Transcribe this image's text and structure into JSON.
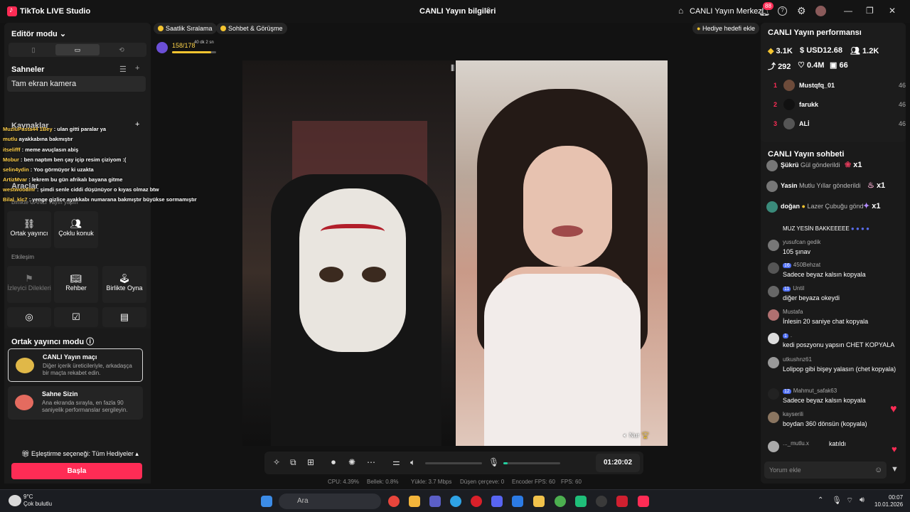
{
  "titlebar": {
    "app_title": "TikTok LIVE Studio",
    "center_title": "CANLI Yayın bilgileri",
    "live_center": "CANLI Yayın Merkezi",
    "notif_count": "88"
  },
  "left": {
    "mode_label": "Editör modu",
    "scenes_label": "Sahneler",
    "scene_item": "Tam ekran kamera",
    "sources_label": "Kaynaklar",
    "tools_label": "Araçlar",
    "together_label": "Birlikte CANLI Yayın yapın",
    "tools": [
      {
        "label": "Ortak yayıncı",
        "icon": "link-icon"
      },
      {
        "label": "Çoklu konuk",
        "icon": "users-icon"
      }
    ],
    "interaction_label": "Etkileşim",
    "interaction_tools": [
      {
        "label": "İzleyici Dilekleri",
        "icon": "wish-icon"
      },
      {
        "label": "Rehber",
        "icon": "book-icon"
      },
      {
        "label": "Birlikte Oyna",
        "icon": "joystick-icon"
      }
    ],
    "cohost_mode": "Ortak yayıncı modu",
    "cards": [
      {
        "title": "CANLI Yayın maçı",
        "desc": "Diğer içerik üreticileriyle, arkadaşça bir maçta rekabet edin."
      },
      {
        "title": "Sahne Sizin",
        "desc": "Ana ekranda sırayla, en fazla 90 saniyelik performanslar sergileyin."
      }
    ],
    "match_option": "Eşleştirme seçeneği: Tüm Hediyeler",
    "start_button": "Başla"
  },
  "overlay_chat": [
    {
      "user": "MuzluPasta44 1Bey",
      "text": " : ulan gitti paralar ya"
    },
    {
      "user": "mutlu",
      "text": " ayakkabına bakmıştır"
    },
    {
      "user": "itselifff",
      "text": " : meme avuçlasın abiş"
    },
    {
      "user": "Mobur",
      "text": " : ben naptım ben çay içip resim çiziyom :("
    },
    {
      "user": "selin4ydin",
      "text": " : Yoo görmüyor ki uzakta"
    },
    {
      "user": "ArtizMvar",
      "text": " : lekrem bu gün afrikalı bayana gitme"
    },
    {
      "user": "westwoodmr",
      "text": " : şimdi senle ciddi düşünüyor o kıyas olmaz btw"
    },
    {
      "user": "Bilal_klc7",
      "text": " : yenge gizlice ayakkabı numarana bakmıştır büyükse sormamıştır"
    }
  ],
  "stage": {
    "chip_ranking": "Saatlik Sıralama",
    "chip_chat": "Sohbet & Görüşme",
    "gift_goal": "Hediye hedefi ekle",
    "progress_text": "158/178",
    "progress_sub": "40 dk 2 sn",
    "progress_fraction": 0.89,
    "guest_name": "Nur",
    "timer": "01:20:02",
    "mic_level": 0.08
  },
  "stats": {
    "cpu": "CPU:  4.39%",
    "mem": "Bellek:  0.8%",
    "upload": "Yükle:  3.7 Mbps",
    "dropped": "Düşen çerçeve:  0",
    "encoder": "Encoder FPS:  60",
    "fps": "FPS:  60"
  },
  "right": {
    "perf_title": "CANLI Yayın performansı",
    "diamonds": "3.1K",
    "usd": "USD12.68",
    "viewers": "1.2K",
    "shares": "292",
    "likes": "0.4M",
    "followers": "66",
    "ranking": [
      {
        "rank": "1",
        "name": "Mustqfq_01",
        "score": "46"
      },
      {
        "rank": "2",
        "name": "farukk",
        "score": "46"
      },
      {
        "rank": "3",
        "name": "ALİ",
        "score": "46"
      }
    ],
    "chat_title": "CANLI Yayın sohbeti",
    "gifts": [
      {
        "user": "Şükrü",
        "text": "Gül gönderildi",
        "count": "x1"
      },
      {
        "user": "Yasin",
        "text": "Mutlu Yıllar gönderildi",
        "count": "x1"
      },
      {
        "user": "doğan",
        "text": "Lazer Çubuğu gönd",
        "count": "x1"
      }
    ],
    "pinned": "MUZ YESİN BAKKEEEEE",
    "messages": [
      {
        "level": "",
        "user": "yusufcan gedik",
        "text": "105 şınav"
      },
      {
        "level": "16",
        "user": "450Behzat",
        "text": "Sadece beyaz kalsın kopyala"
      },
      {
        "level": "11",
        "user": "Until",
        "text": "diğer beyaza okeydi"
      },
      {
        "level": "",
        "user": "Mustafa",
        "text": "İnlesin 20 saniye chat kopyala"
      },
      {
        "level": "1",
        "user": ".",
        "text": "kedi poszyonu yapsın CHET KOPYALA"
      },
      {
        "level": "",
        "user": "utkushnz61",
        "text": "Lolipop gibi bişey yalasın (chet kopyala)"
      },
      {
        "level": "12",
        "user": "Mahmut_safak63",
        "text": "Sadece beyaz kalsın kopyala"
      },
      {
        "level": "",
        "user": "kayserili",
        "text": "boydan 360 dönsün (kopyala)"
      },
      {
        "level": "",
        "user": "..._mutlu.x",
        "text": "katıldı"
      }
    ],
    "comment_placeholder": "Yorum ekle"
  },
  "taskbar": {
    "temp": "9°C",
    "weather": "Çok bulutlu",
    "search": "Ara",
    "time": "00:07",
    "date": "10.01.2026"
  },
  "colors": {
    "accent": "#fe2c55",
    "gold": "#f4c430",
    "level": "#4e6ef2"
  }
}
